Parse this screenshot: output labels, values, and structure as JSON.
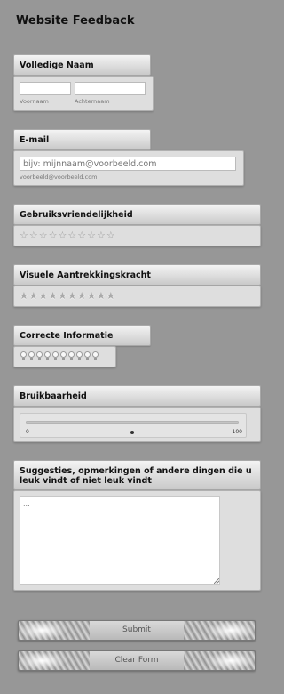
{
  "form": {
    "title": "Website Feedback"
  },
  "name_field": {
    "label": "Volledige Naam",
    "first_sublabel": "Voornaam",
    "last_sublabel": "Achternaam",
    "first_value": "",
    "last_value": ""
  },
  "email_field": {
    "label": "E-mail",
    "placeholder": "bijv: mijnnaam@voorbeeld.com",
    "sublabel": "voorbeeld@voorbeeld.com"
  },
  "usability_field": {
    "label": "Gebruiksvriendelijkheid",
    "max": 10,
    "value": 0,
    "icon": "star-outline-icon"
  },
  "visual_field": {
    "label": "Visuele Aantrekkingskracht",
    "max": 10,
    "value": 0,
    "icon": "star-solid-icon"
  },
  "info_field": {
    "label": "Correcte Informatie",
    "max": 10,
    "value": 0,
    "icon": "lightbulb-icon"
  },
  "slider_field": {
    "label": "Bruikbaarheid",
    "min_label": "0",
    "max_label": "100",
    "min": 0,
    "max": 100,
    "value": 50
  },
  "suggestions_field": {
    "label": "Suggesties, opmerkingen of andere dingen die u leuk vindt of niet leuk vindt",
    "placeholder": "..."
  },
  "buttons": {
    "submit": "Submit",
    "clear": "Clear Form"
  }
}
